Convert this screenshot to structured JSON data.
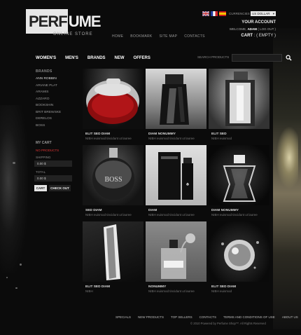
{
  "header": {
    "logo_left": "PERF",
    "logo_right": "UME",
    "tagline": "ONLINE STORE",
    "top_links": [
      "HOME",
      "BOOKMARK",
      "SITE MAP",
      "CONTACTS"
    ],
    "currencies_label": "CURRENCIES",
    "currency_value": "US DOLLAR",
    "your_account": "YOUR ACCOUNT",
    "welcome_prefix": "WELCOME,",
    "welcome_user": "ADAM",
    "logout": "( LOG OUT )",
    "cart_label": "CART",
    "cart_status": ": ( EMPTY )"
  },
  "nav": {
    "items": [
      "WOMEN'S",
      "MEN'S",
      "BRANDS",
      "NEW",
      "OFFERS"
    ],
    "search_placeholder": "SEARCH PRODUCTS"
  },
  "sidebar": {
    "brands_title": "BRANDS",
    "brands": [
      "ANN ROBBIN",
      "ARIANE PLAT",
      "ARAMIS",
      "AZZARO",
      "BOOKSHIN",
      "BRIT BREWSKE",
      "DERELOS",
      "BOSS"
    ],
    "cart_title": "MY CART",
    "cart_items": "NO PRODUCTS",
    "shipping_label": "SHIPPING",
    "shipping_value": "0.00 $",
    "total_label": "TOTAL",
    "total_value": "0.00 $",
    "cart_button": "CART",
    "checkout_button": "CHECK OUT"
  },
  "products": [
    {
      "name": "ELIT SED DIAM",
      "desc": "NIBH euismod tincidunt ut laoree"
    },
    {
      "name": "DIAM NONUMMY",
      "desc": "NIBH euismod tincidunt ut laoree"
    },
    {
      "name": "ELIT SED",
      "desc": "NIBH euismod"
    },
    {
      "name": "SED DIAM",
      "desc": "NIBH euismod tincidunt ut laoree"
    },
    {
      "name": "DIAM",
      "desc": "NIBH euismod tincidunt ut laoree"
    },
    {
      "name": "DIAM NONUMMY",
      "desc": "NIBH euismod tincidunt ut laoree"
    },
    {
      "name": "ELIT SED DIAM",
      "desc": "NIBH"
    },
    {
      "name": "NONUMMY",
      "desc": "NIBH euismod tincidunt ut laoree"
    },
    {
      "name": "ELIT SED DIAM",
      "desc": "NIBH euismod"
    }
  ],
  "footer": {
    "links": [
      "SPECIALS",
      "NEW PRODUCTS",
      "TOP SELLERS",
      "CONTACTS",
      "TERMS AND CONDITIONS OF USE",
      "ABOUT US"
    ],
    "copyright": "© 2010 Powered by Perfume Shop™. All Rights Reserved"
  },
  "colors": {
    "background": "#0b0b0b",
    "accent_red": "#dd3333"
  }
}
